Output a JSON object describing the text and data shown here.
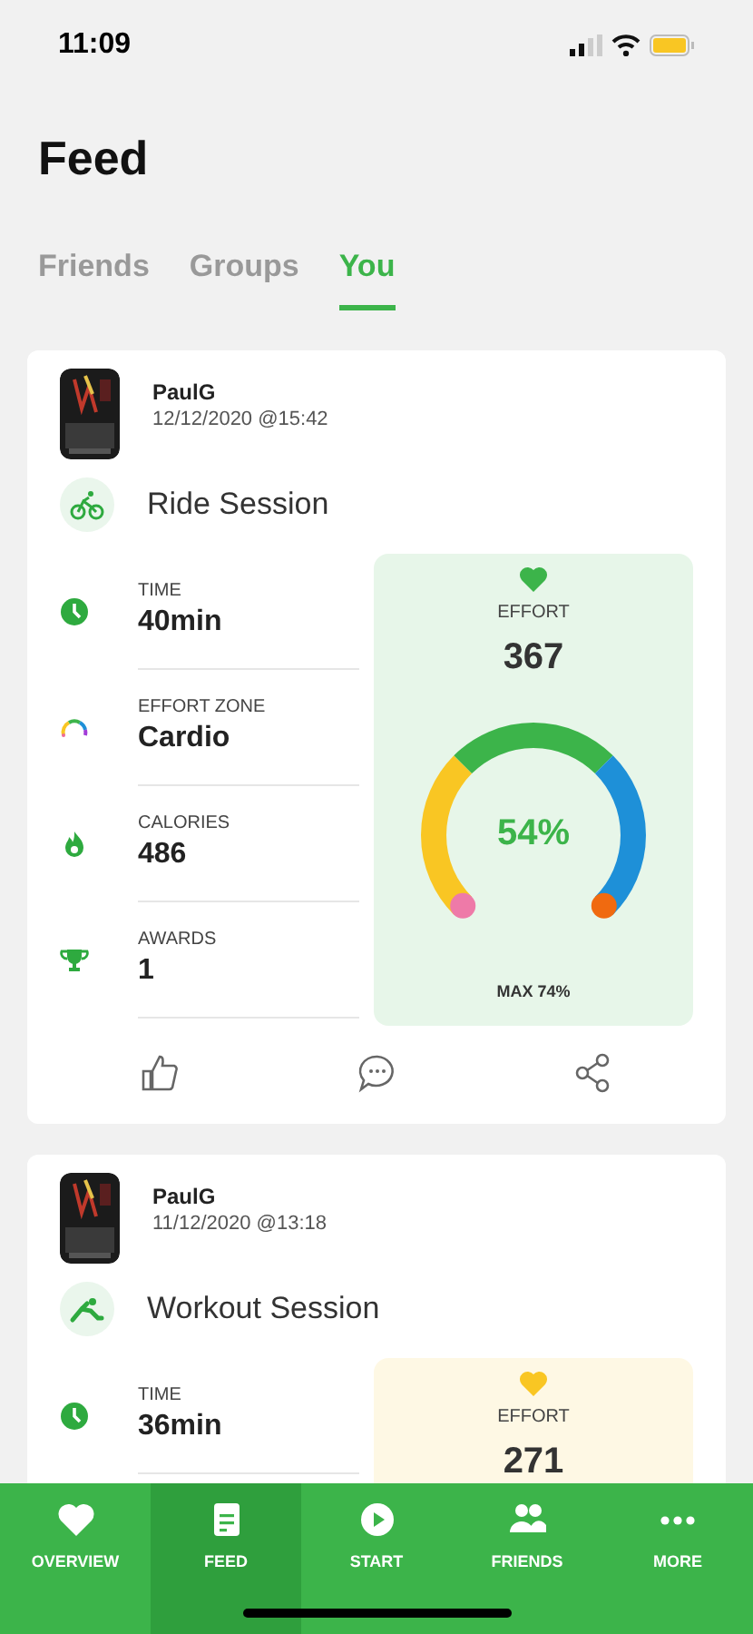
{
  "status_bar": {
    "time": "11:09"
  },
  "title": "Feed",
  "tabs": [
    {
      "label": "Friends",
      "selected": false
    },
    {
      "label": "Groups",
      "selected": false
    },
    {
      "label": "You",
      "selected": true
    }
  ],
  "sessions": [
    {
      "user": "PaulG",
      "date": "12/12/2020 @15:42",
      "activity": "Ride Session",
      "kind": "ride",
      "stats": [
        {
          "kind": "time",
          "label": "TIME",
          "value": "40min"
        },
        {
          "kind": "zone",
          "label": "EFFORT ZONE",
          "value": "Cardio"
        },
        {
          "kind": "calories",
          "label": "CALORIES",
          "value": "486"
        },
        {
          "kind": "awards",
          "label": "AWARDS",
          "value": "1"
        }
      ],
      "effort": {
        "label": "EFFORT",
        "value": "367",
        "color": "#3cb44a",
        "gauge": "54%",
        "max": "MAX 74%"
      },
      "actions": [
        {
          "kind": "like"
        },
        {
          "kind": "comment"
        },
        {
          "kind": "share"
        }
      ]
    },
    {
      "user": "PaulG",
      "date": "11/12/2020 @13:18",
      "activity": "Workout Session",
      "kind": "workout",
      "stats": [
        {
          "kind": "time",
          "label": "TIME",
          "value": "36min"
        }
      ],
      "effort": {
        "label": "EFFORT",
        "value": "271",
        "color": "#f9c623"
      }
    }
  ],
  "nav": [
    {
      "kind": "overview",
      "label": "OVERVIEW",
      "selected": false
    },
    {
      "kind": "feed",
      "label": "FEED",
      "selected": true
    },
    {
      "kind": "start",
      "label": "START",
      "selected": false
    },
    {
      "kind": "friends",
      "label": "FRIENDS",
      "selected": false
    },
    {
      "kind": "more",
      "label": "MORE",
      "selected": false
    }
  ]
}
